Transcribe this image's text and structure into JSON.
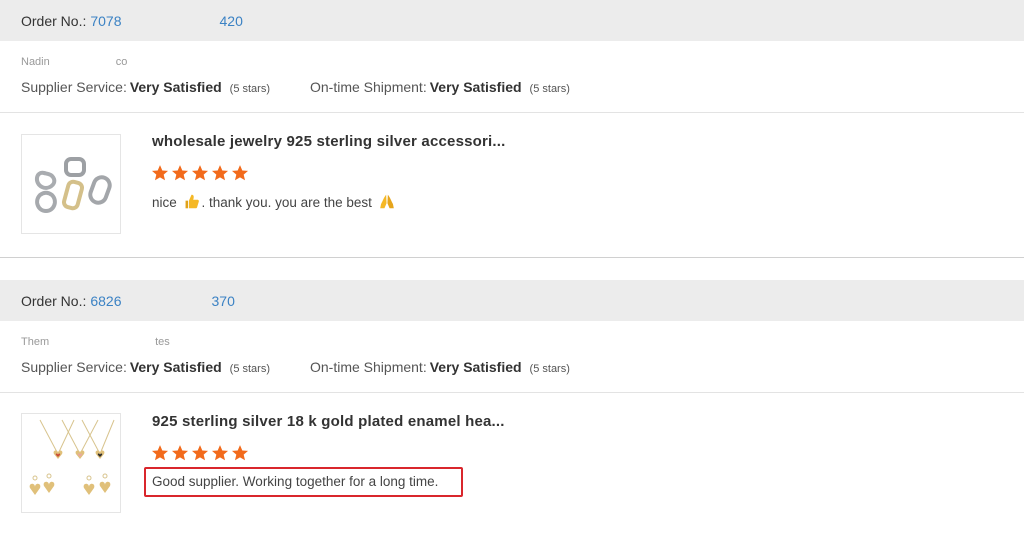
{
  "orders": [
    {
      "order_label": "Order No.:",
      "order_number_prefix": "7078",
      "order_number_suffix": "420",
      "buyer_name_prefix": "Nadin",
      "buyer_name_suffix": "co",
      "supplier_service_label": "Supplier Service:",
      "supplier_service_value": "Very Satisfied",
      "supplier_service_stars": "(5 stars)",
      "ontime_label": "On-time Shipment:",
      "ontime_value": "Very Satisfied",
      "ontime_stars": "(5 stars)",
      "product_title": "wholesale jewelry 925 sterling silver accessori...",
      "rating": 5,
      "comment_part1": "nice",
      "comment_part2": ". thank you. you are the best",
      "product_image": "silver-clasps-image"
    },
    {
      "order_label": "Order No.:",
      "order_number_prefix": "6826",
      "order_number_suffix": "370",
      "buyer_name_prefix": "Them",
      "buyer_name_suffix": "tes",
      "supplier_service_label": "Supplier Service:",
      "supplier_service_value": "Very Satisfied",
      "supplier_service_stars": "(5 stars)",
      "ontime_label": "On-time Shipment:",
      "ontime_value": "Very Satisfied",
      "ontime_stars": "(5 stars)",
      "product_title": "925 sterling silver 18 k gold plated enamel hea...",
      "rating": 5,
      "comment": "Good supplier. Working together for a long time.",
      "product_image": "heart-necklaces-image"
    }
  ],
  "colors": {
    "header_bg": "#ececec",
    "order_link": "#3b82c4",
    "star": "#f26a1b",
    "highlight_border": "#d9262c"
  },
  "icons": {
    "thumbs_up": "thumbs-up-emoji",
    "folded_hands": "folded-hands-emoji",
    "star": "star-icon"
  }
}
